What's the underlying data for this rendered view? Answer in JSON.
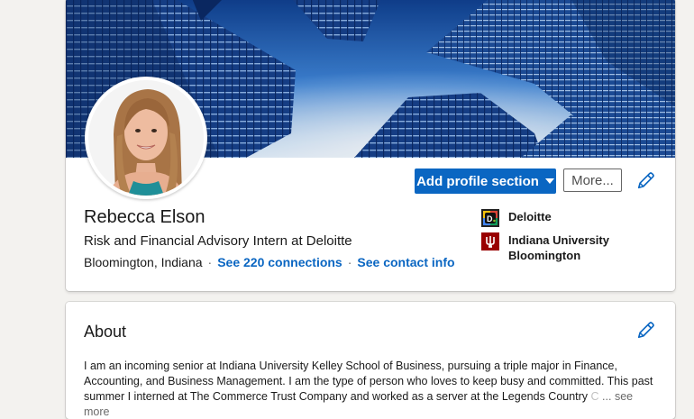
{
  "profile": {
    "name": "Rebecca Elson",
    "headline": "Risk and Financial Advisory Intern at Deloitte",
    "location": "Bloomington, Indiana",
    "separator": "·",
    "connections_link": "See 220 connections",
    "contact_link": "See contact info",
    "add_section_button": "Add profile section",
    "more_button": "More...",
    "experience": [
      {
        "name": "Deloitte",
        "logo_icon": "deloitte-logo-icon"
      },
      {
        "name": "Indiana University Bloomington",
        "logo_icon": "iu-trident-logo-icon"
      }
    ]
  },
  "about": {
    "title": "About",
    "text": "I am an incoming senior at Indiana University Kelley School of Business, pursuing a triple major in Finance, Accounting, and Business Management. I am the type of person who loves to keep busy and committed. This past summer I interned at The Commerce Trust Company and worked as a server at the Legends Country ",
    "faded": "C",
    "see_more": "... see more"
  },
  "colors": {
    "accent": "#0a66c2",
    "page_background": "#f3f2ef",
    "iu_crimson": "#990000"
  }
}
